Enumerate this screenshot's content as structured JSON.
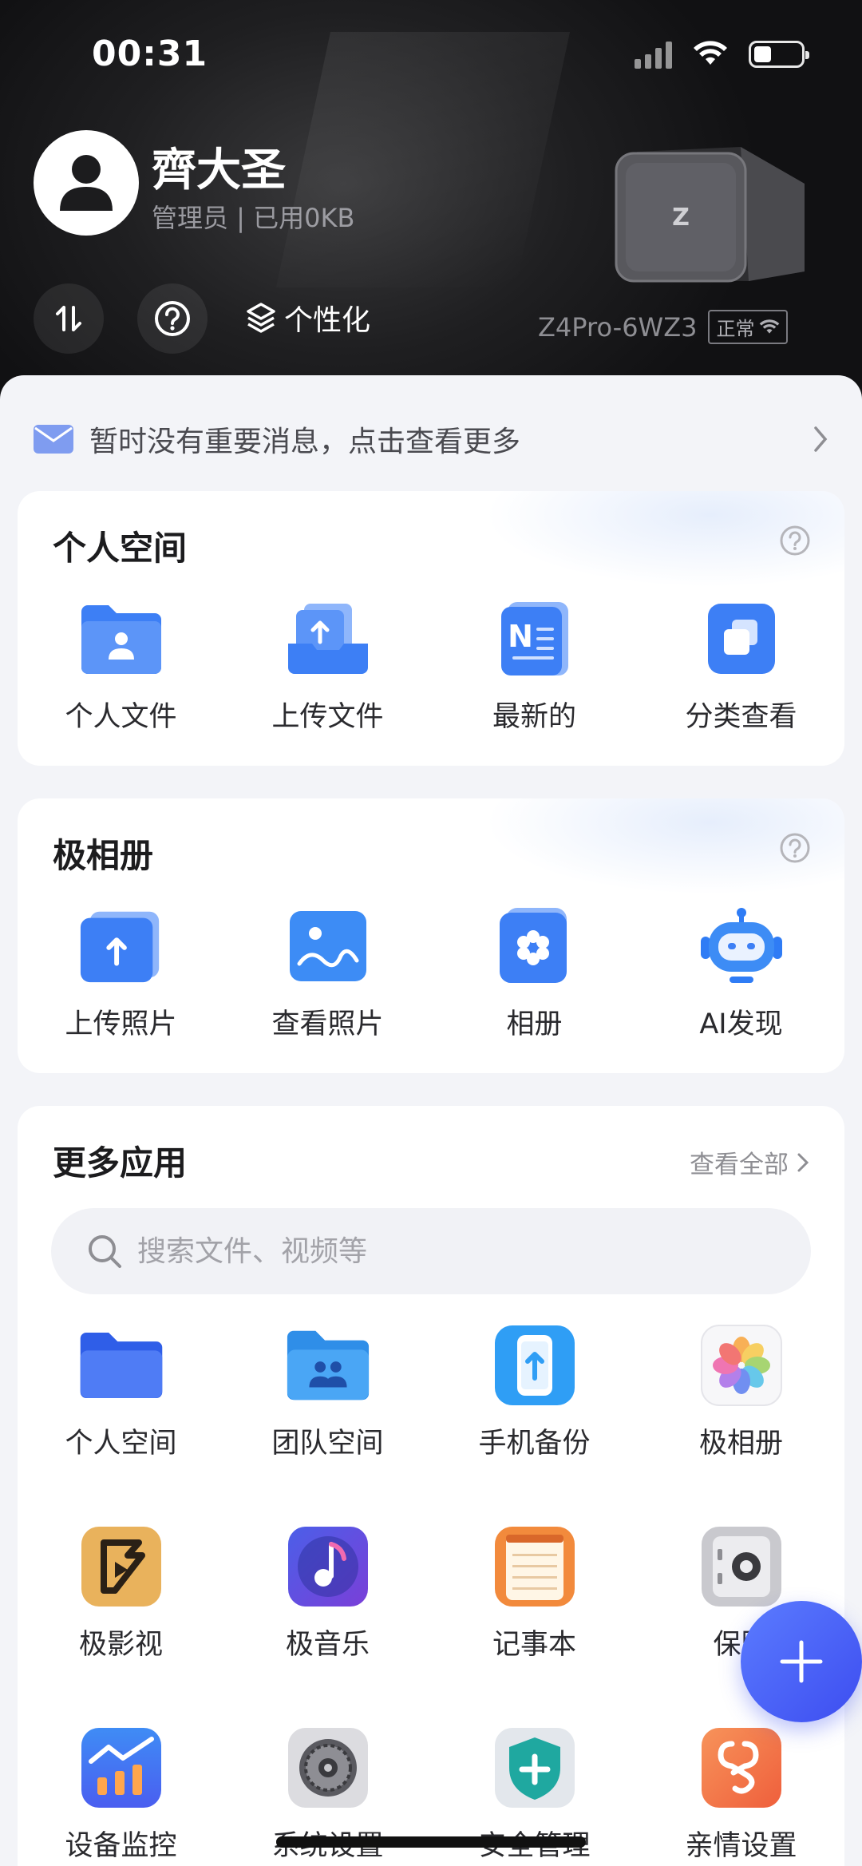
{
  "status_bar": {
    "time": "00:31"
  },
  "user": {
    "name": "齊大圣",
    "role_usage": "管理员 | 已用0KB"
  },
  "header": {
    "personalize_label": "个性化"
  },
  "device": {
    "name": "Z4Pro-6WZ3",
    "status": "正常"
  },
  "notice": {
    "text": "暂时没有重要消息，点击查看更多"
  },
  "personal_space": {
    "title": "个人空间",
    "items": [
      {
        "label": "个人文件",
        "icon": "person-folder-icon"
      },
      {
        "label": "上传文件",
        "icon": "upload-tray-icon"
      },
      {
        "label": "最新的",
        "icon": "notes-n-icon"
      },
      {
        "label": "分类查看",
        "icon": "stacked-squares-icon"
      }
    ]
  },
  "album": {
    "title": "极相册",
    "items": [
      {
        "label": "上传照片",
        "icon": "upload-photo-icon"
      },
      {
        "label": "查看照片",
        "icon": "landscape-photo-icon"
      },
      {
        "label": "相册",
        "icon": "flower-album-icon"
      },
      {
        "label": "AI发现",
        "icon": "robot-icon"
      }
    ]
  },
  "more_apps": {
    "title": "更多应用",
    "see_all": "查看全部",
    "search_placeholder": "搜索文件、视频等",
    "rows": [
      [
        {
          "label": "个人空间",
          "icon": "blue-folder-icon"
        },
        {
          "label": "团队空间",
          "icon": "team-folder-icon"
        },
        {
          "label": "手机备份",
          "icon": "phone-backup-icon"
        },
        {
          "label": "极相册",
          "icon": "photos-flower-icon"
        }
      ],
      [
        {
          "label": "极影视",
          "icon": "film-reel-icon"
        },
        {
          "label": "极音乐",
          "icon": "music-note-icon"
        },
        {
          "label": "记事本",
          "icon": "notepad-icon"
        },
        {
          "label": "保险",
          "icon": "safe-icon"
        }
      ],
      [
        {
          "label": "设备监控",
          "icon": "monitor-chart-icon"
        },
        {
          "label": "系统设置",
          "icon": "gear-icon"
        },
        {
          "label": "安全管理",
          "icon": "shield-plus-icon"
        },
        {
          "label": "亲情设置",
          "icon": "family-icon"
        }
      ]
    ]
  },
  "colors": {
    "accent": "#4b63f5",
    "header_bg": "#1c1c1e",
    "icon_blue": "#3f7bf5"
  }
}
